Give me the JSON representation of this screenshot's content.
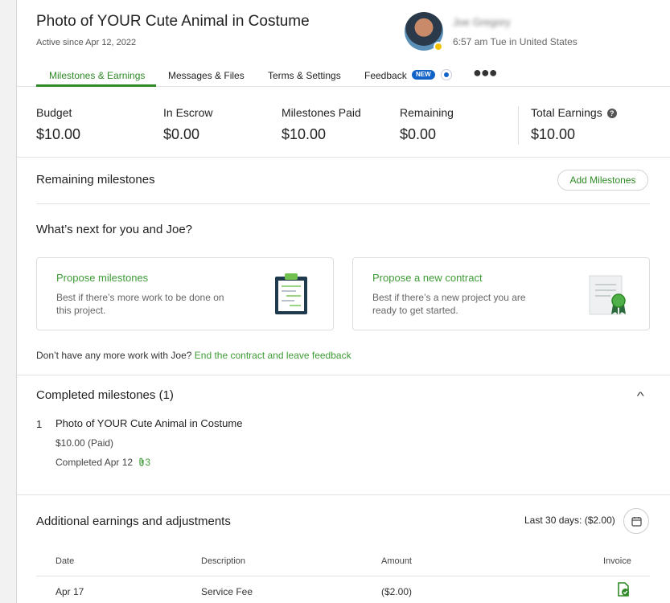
{
  "header": {
    "title": "Photo of YOUR Cute Animal in Costume",
    "active_since": "Active since Apr 12, 2022",
    "user_name": "Joe Gregory",
    "user_time": "6:57 am Tue in United States"
  },
  "tabs": [
    {
      "label": "Milestones & Earnings"
    },
    {
      "label": "Messages & Files"
    },
    {
      "label": "Terms & Settings"
    },
    {
      "label": "Feedback"
    }
  ],
  "feedback_badge": "NEW",
  "stats": [
    {
      "label": "Budget",
      "value": "$10.00"
    },
    {
      "label": "In Escrow",
      "value": "$0.00"
    },
    {
      "label": "Milestones Paid",
      "value": "$10.00"
    },
    {
      "label": "Remaining",
      "value": "$0.00"
    },
    {
      "label": "Total Earnings",
      "value": "$10.00"
    }
  ],
  "remaining": {
    "title": "Remaining milestones",
    "add_button": "Add Milestones"
  },
  "whats_next": {
    "title": "What’s next for you and Joe?",
    "cards": [
      {
        "title": "Propose milestones",
        "desc": "Best if there’s more work to be done on this project."
      },
      {
        "title": "Propose a new contract",
        "desc": "Best if there’s a new project you are ready to get started."
      }
    ],
    "end_prompt": "Don’t have any more work with Joe?",
    "end_link": "End the contract and leave feedback"
  },
  "completed": {
    "title": "Completed milestones (1)",
    "items": [
      {
        "number": "1",
        "title": "Photo of YOUR Cute Animal in Costume",
        "price": "$10.00 (Paid)",
        "completed": "Completed Apr 12",
        "attachments": "3"
      }
    ]
  },
  "additional": {
    "title": "Additional earnings and adjustments",
    "range": "Last 30 days: ($2.00)",
    "columns": [
      "Date",
      "Description",
      "Amount",
      "Invoice"
    ],
    "rows": [
      {
        "date": "Apr 17",
        "description": "Service Fee",
        "amount": "($2.00)"
      }
    ]
  },
  "icons": {
    "help": "help-circle-icon",
    "more": "more-dots-icon",
    "chevron": "chevron-up-icon",
    "calendar": "calendar-icon",
    "invoice": "invoice-check-icon",
    "clipboard": "clipboard-illustration-icon",
    "certificate": "certificate-illustration-icon",
    "paperclip": "paperclip-icon"
  },
  "colors": {
    "accent": "#2e8a26",
    "link": "#3d9b35",
    "badge": "#1263c7",
    "presence": "#f2c200"
  }
}
